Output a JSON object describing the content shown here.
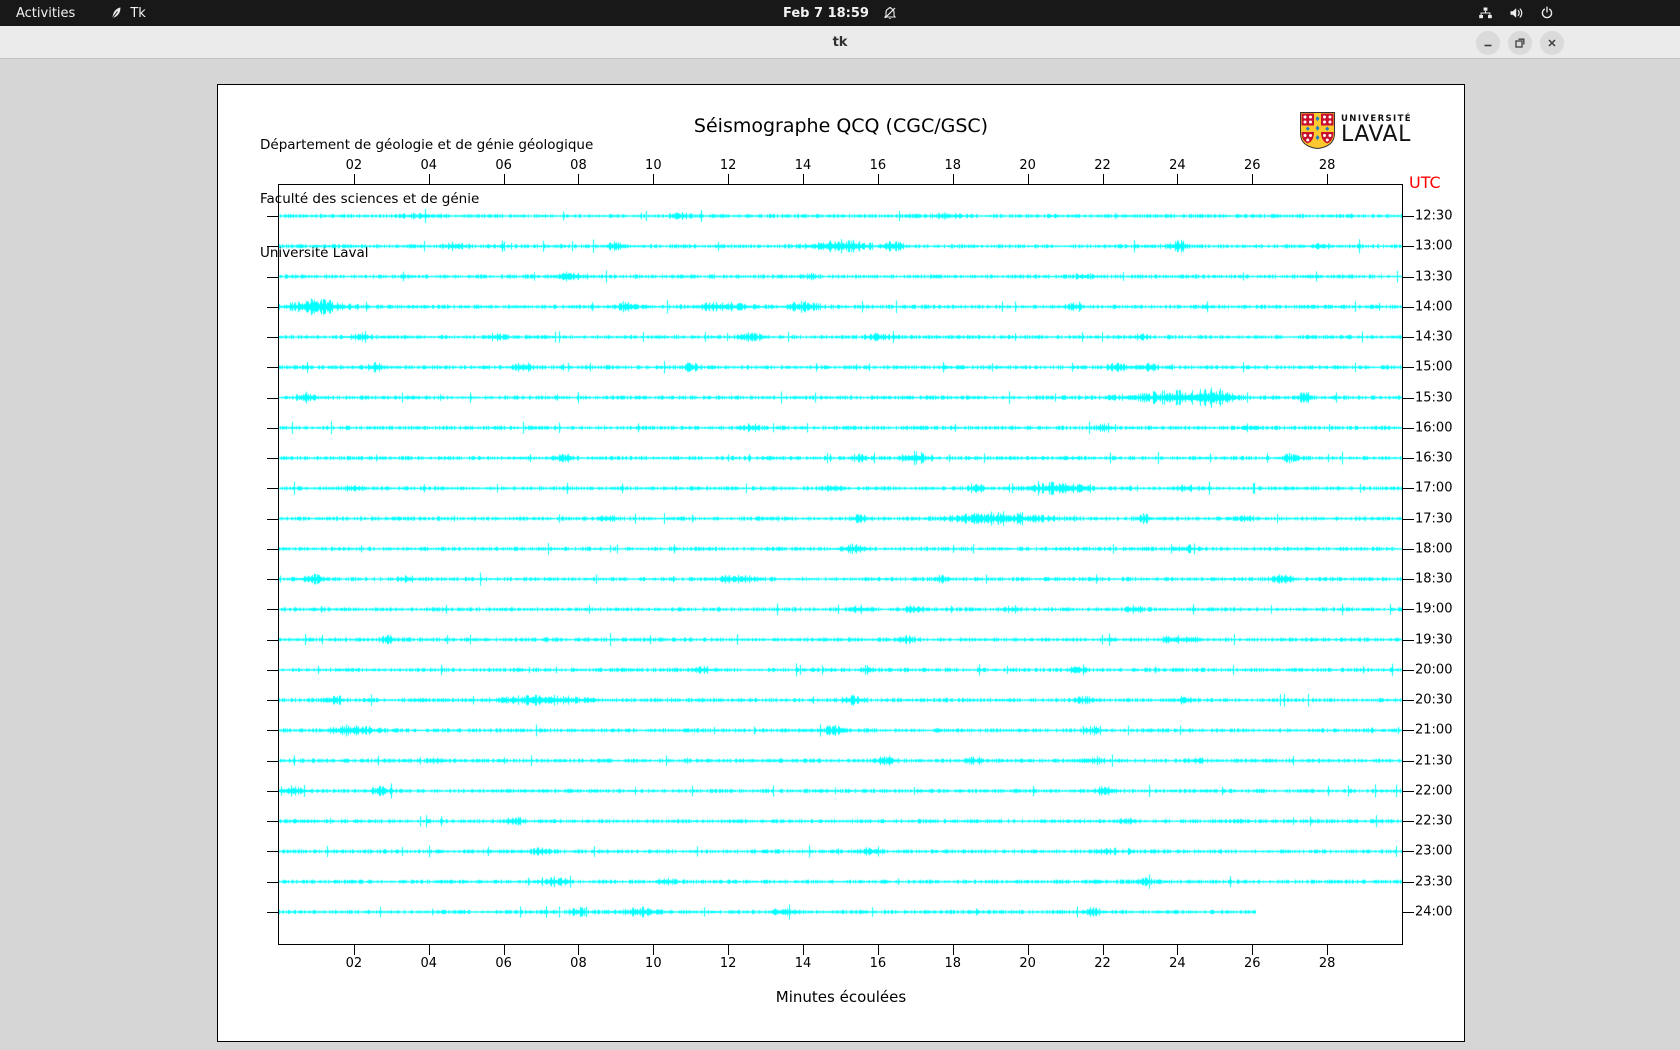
{
  "topbar": {
    "activities_label": "Activities",
    "app_name": "Tk",
    "clock": "Feb 7  18:59",
    "icons": [
      "tk-feather",
      "notifications-off",
      "network",
      "volume",
      "power"
    ]
  },
  "titlebar": {
    "title": "tk",
    "buttons": [
      "minimize",
      "maximize",
      "close"
    ]
  },
  "panel": {
    "institution_lines": [
      "Département de géologie et de génie géologique",
      "Faculté des sciences et de génie",
      "Université Laval"
    ],
    "logo": {
      "line1": "UNIVERSITÉ",
      "line2": "LAVAL"
    }
  },
  "chart_data": {
    "type": "line",
    "title": "Séismographe QCQ (CGC/GSC)",
    "xlabel": "Minutes écoulées",
    "right_axis_label": "UTC",
    "x_range_minutes": [
      0,
      30
    ],
    "x_ticks": [
      "02",
      "04",
      "06",
      "08",
      "10",
      "12",
      "14",
      "16",
      "18",
      "20",
      "22",
      "24",
      "26",
      "28"
    ],
    "trace_color": "#00ffff",
    "trace_interval_minutes": 30,
    "grid": false,
    "traces": [
      {
        "utc": "12:30",
        "end_minute": 30,
        "seed": 1234,
        "bursts": [
          [
            3.8,
            0.3,
            0.8
          ],
          [
            10.7,
            0.15,
            1.5
          ],
          [
            17.8,
            0.2,
            1.2
          ]
        ]
      },
      {
        "utc": "13:00",
        "end_minute": 30,
        "seed": 1331,
        "bursts": [
          [
            4.7,
            0.2,
            1.2
          ],
          [
            9.0,
            0.15,
            2.2
          ],
          [
            15.0,
            0.5,
            2.6
          ],
          [
            16.4,
            0.15,
            2.0
          ],
          [
            24.0,
            0.2,
            2.2
          ],
          [
            27.8,
            0.15,
            1.2
          ]
        ]
      },
      {
        "utc": "13:30",
        "end_minute": 30,
        "seed": 1428,
        "bursts": [
          [
            7.8,
            0.3,
            1.4
          ],
          [
            14.2,
            0.15,
            0.9
          ],
          [
            21.5,
            0.2,
            0.8
          ]
        ]
      },
      {
        "utc": "14:00",
        "end_minute": 30,
        "seed": 1525,
        "bursts": [
          [
            1.0,
            0.5,
            2.8
          ],
          [
            9.3,
            0.15,
            2.0
          ],
          [
            11.8,
            0.5,
            1.6
          ],
          [
            14.0,
            0.3,
            1.8
          ],
          [
            21.2,
            0.15,
            1.6
          ]
        ]
      },
      {
        "utc": "14:30",
        "end_minute": 30,
        "seed": 1622,
        "bursts": [
          [
            2.2,
            0.15,
            1.6
          ],
          [
            5.8,
            0.15,
            1.2
          ],
          [
            12.6,
            0.2,
            1.5
          ],
          [
            16.0,
            0.2,
            1.3
          ],
          [
            23.0,
            0.15,
            0.9
          ]
        ]
      },
      {
        "utc": "15:00",
        "end_minute": 30,
        "seed": 1719,
        "bursts": [
          [
            2.6,
            0.15,
            1.8
          ],
          [
            6.5,
            0.2,
            1.6
          ],
          [
            11.0,
            0.15,
            1.3
          ],
          [
            22.4,
            0.2,
            1.5
          ],
          [
            23.2,
            0.15,
            1.2
          ]
        ]
      },
      {
        "utc": "15:30",
        "end_minute": 30,
        "seed": 1816,
        "bursts": [
          [
            0.7,
            0.15,
            1.8
          ],
          [
            24.1,
            0.9,
            2.6
          ],
          [
            25.0,
            0.3,
            2.2
          ],
          [
            27.4,
            0.1,
            2.8
          ]
        ]
      },
      {
        "utc": "16:00",
        "end_minute": 30,
        "seed": 1913,
        "bursts": [
          [
            12.6,
            0.15,
            1.4
          ],
          [
            22.0,
            0.15,
            1.2
          ]
        ]
      },
      {
        "utc": "16:30",
        "end_minute": 30,
        "seed": 2010,
        "bursts": [
          [
            7.6,
            0.15,
            1.5
          ],
          [
            15.5,
            0.15,
            1.4
          ],
          [
            17.0,
            0.25,
            2.4
          ],
          [
            27.0,
            0.15,
            1.5
          ]
        ]
      },
      {
        "utc": "17:00",
        "end_minute": 30,
        "seed": 2107,
        "bursts": [
          [
            2.0,
            0.15,
            1.2
          ],
          [
            14.8,
            0.15,
            1.3
          ],
          [
            18.6,
            0.15,
            1.5
          ],
          [
            20.8,
            0.5,
            2.2
          ],
          [
            24.2,
            0.15,
            1.3
          ]
        ]
      },
      {
        "utc": "17:30",
        "end_minute": 30,
        "seed": 2204,
        "bursts": [
          [
            8.8,
            0.15,
            1.3
          ],
          [
            15.5,
            0.15,
            1.4
          ],
          [
            19.2,
            0.8,
            2.4
          ],
          [
            23.1,
            0.15,
            1.5
          ],
          [
            25.8,
            0.15,
            1.4
          ]
        ]
      },
      {
        "utc": "18:00",
        "end_minute": 30,
        "seed": 2301,
        "bursts": [
          [
            15.4,
            0.2,
            2.0
          ],
          [
            24.3,
            0.15,
            1.1
          ]
        ]
      },
      {
        "utc": "18:30",
        "end_minute": 30,
        "seed": 2398,
        "bursts": [
          [
            0.9,
            0.2,
            1.6
          ],
          [
            3.4,
            0.15,
            1.4
          ],
          [
            12.2,
            0.3,
            1.6
          ],
          [
            17.7,
            0.15,
            1.2
          ],
          [
            26.8,
            0.2,
            1.5
          ]
        ]
      },
      {
        "utc": "19:00",
        "end_minute": 30,
        "seed": 2495,
        "bursts": [
          [
            15.5,
            0.15,
            1.3
          ],
          [
            17.0,
            0.2,
            1.4
          ],
          [
            19.6,
            0.15,
            1.2
          ],
          [
            22.9,
            0.15,
            1.3
          ]
        ]
      },
      {
        "utc": "19:30",
        "end_minute": 30,
        "seed": 2592,
        "bursts": [
          [
            2.9,
            0.15,
            1.4
          ],
          [
            16.8,
            0.15,
            1.3
          ],
          [
            23.9,
            0.2,
            1.5
          ],
          [
            24.4,
            0.15,
            1.2
          ]
        ]
      },
      {
        "utc": "20:00",
        "end_minute": 30,
        "seed": 2689,
        "bursts": [
          [
            11.3,
            0.15,
            1.2
          ],
          [
            15.7,
            0.15,
            1.3
          ],
          [
            21.3,
            0.15,
            1.0
          ]
        ]
      },
      {
        "utc": "20:30",
        "end_minute": 30,
        "seed": 2786,
        "bursts": [
          [
            1.5,
            0.15,
            1.5
          ],
          [
            7.0,
            0.7,
            1.8
          ],
          [
            15.3,
            0.2,
            1.6
          ],
          [
            21.5,
            0.15,
            1.2
          ],
          [
            24.2,
            0.15,
            1.3
          ]
        ]
      },
      {
        "utc": "21:00",
        "end_minute": 30,
        "seed": 2883,
        "bursts": [
          [
            1.9,
            0.4,
            2.0
          ],
          [
            14.8,
            0.2,
            1.6
          ],
          [
            21.7,
            0.15,
            1.1
          ]
        ]
      },
      {
        "utc": "21:30",
        "end_minute": 30,
        "seed": 2980,
        "bursts": [
          [
            4.2,
            0.15,
            1.2
          ],
          [
            16.2,
            0.2,
            1.6
          ],
          [
            18.5,
            0.15,
            1.2
          ],
          [
            21.8,
            0.15,
            1.3
          ],
          [
            24.5,
            0.15,
            1.2
          ]
        ]
      },
      {
        "utc": "22:00",
        "end_minute": 30,
        "seed": 3077,
        "bursts": [
          [
            0.3,
            0.3,
            1.6
          ],
          [
            2.7,
            0.2,
            1.4
          ],
          [
            22.1,
            0.2,
            1.6
          ]
        ]
      },
      {
        "utc": "22:30",
        "end_minute": 30,
        "seed": 3174,
        "bursts": [
          [
            6.3,
            0.15,
            1.3
          ],
          [
            22.7,
            0.15,
            1.1
          ]
        ]
      },
      {
        "utc": "23:00",
        "end_minute": 30,
        "seed": 3271,
        "bursts": [
          [
            7.0,
            0.15,
            1.3
          ],
          [
            15.8,
            0.2,
            1.5
          ],
          [
            22.1,
            0.15,
            1.2
          ]
        ]
      },
      {
        "utc": "23:30",
        "end_minute": 30,
        "seed": 3368,
        "bursts": [
          [
            7.4,
            0.2,
            1.5
          ],
          [
            10.3,
            0.15,
            1.3
          ],
          [
            23.1,
            0.2,
            1.4
          ]
        ]
      },
      {
        "utc": "24:00",
        "end_minute": 26.1,
        "seed": 3465,
        "bursts": [
          [
            8.0,
            0.15,
            1.4
          ],
          [
            9.7,
            0.3,
            1.6
          ],
          [
            13.4,
            0.15,
            1.4
          ],
          [
            21.7,
            0.2,
            1.5
          ]
        ]
      }
    ]
  },
  "colors": {
    "trace": "#00ffff",
    "utc_label": "#ff0000",
    "panel_bg": "#ffffff",
    "window_bg": "#d6d6d6",
    "topbar_bg": "#181818",
    "titlebar_bg": "#ebebeb",
    "logo_red": "#c8102e",
    "logo_gold": "#ffc82e",
    "logo_blue": "#1e7fc2"
  }
}
